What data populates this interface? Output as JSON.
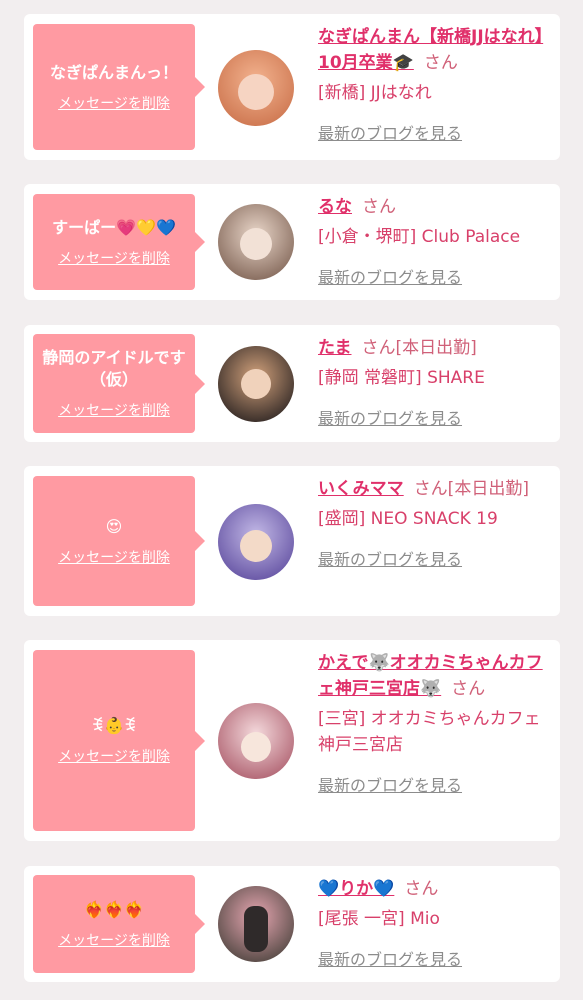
{
  "items": [
    {
      "message": "なぎぱんまんっ！",
      "delete_label": "メッセージを削除",
      "name": "なぎぱんまん【新橋JJはなれ】10月卒業🎓",
      "suffix": "さん",
      "shop": "[新橋] JJはなれ",
      "blog_label": "最新のブログを見る",
      "avatar_colors": [
        "#f3b38f",
        "#d07a54"
      ]
    },
    {
      "message": "すーぱー💗💛💙",
      "delete_label": "メッセージを削除",
      "name": "るな",
      "suffix": "さん",
      "shop": "[小倉・堺町] Club Palace",
      "blog_label": "最新のブログを見る",
      "avatar_colors": [
        "#e9d6c9",
        "#8a6f61"
      ]
    },
    {
      "message": "静岡のアイドルです（仮）",
      "delete_label": "メッセージを削除",
      "name": "たま",
      "suffix": "さん[本日出勤]",
      "shop": "[静岡 常磐町] SHARE",
      "blog_label": "最新のブログを見る",
      "avatar_colors": [
        "#d2a27c",
        "#3c302b"
      ]
    },
    {
      "message": "😍",
      "delete_label": "メッセージを削除",
      "name": "いくみママ",
      "suffix": "さん[本日出勤]",
      "shop": "[盛岡] NEO SNACK 19",
      "blog_label": "最新のブログを見る",
      "avatar_colors": [
        "#c2b8e6",
        "#6b5aa8"
      ]
    },
    {
      "message": "ꉂ👶ꉂ",
      "delete_label": "メッセージを削除",
      "name": "かえで🐺オオカミちゃんカフェ神戸三宮店🐺",
      "suffix": "さん",
      "shop": "[三宮] オオカミちゃんカフェ神戸三宮店",
      "blog_label": "最新のブログを見る",
      "avatar_colors": [
        "#f4d9dc",
        "#b46a78"
      ]
    },
    {
      "message": "❤️‍🔥❤️‍🔥❤️‍🔥",
      "delete_label": "メッセージを削除",
      "name": "💙りか💙",
      "suffix": "さん",
      "shop": "[尾張 一宮] Mio",
      "blog_label": "最新のブログを見る",
      "avatar_colors": [
        "#e7a7b2",
        "#5c4e4a"
      ]
    }
  ]
}
